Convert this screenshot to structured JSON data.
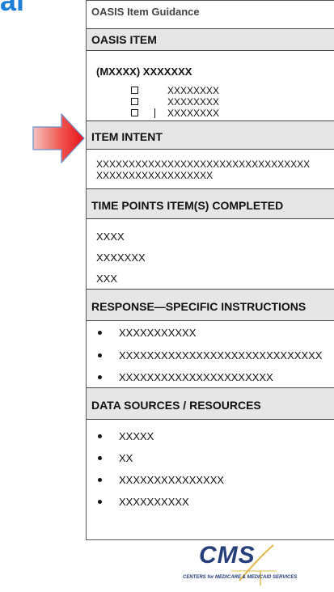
{
  "slide_heading_fragment": "al",
  "document": {
    "title": "OASIS Item Guidance",
    "sections": {
      "oasis_item": {
        "header": "OASIS ITEM",
        "item_line": "(MXXXX) XXXXXXX",
        "options": [
          "XXXXXXXX",
          "XXXXXXXX",
          "XXXXXXXX"
        ]
      },
      "item_intent": {
        "header": "ITEM INTENT",
        "lines": [
          "XXXXXXXXXXXXXXXXXXXXXXXXXXXXXXXXX",
          "XXXXXXXXXXXXXXXXXX"
        ]
      },
      "time_points": {
        "header": "TIME POINTS ITEM(S) COMPLETED",
        "lines": [
          "XXXX",
          "XXXXXXX",
          "XXX"
        ]
      },
      "response_instructions": {
        "header": "RESPONSE—SPECIFIC INSTRUCTIONS",
        "bullets": [
          "XXXXXXXXXXX",
          "XXXXXXXXXXXXXXXXXXXXXXXXXXXXX",
          "XXXXXXXXXXXXXXXXXXXXXX"
        ]
      },
      "data_sources": {
        "header": "DATA SOURCES / RESOURCES",
        "bullets": [
          "XXXXX",
          "XX",
          "XXXXXXXXXXXXXXX",
          "XXXXXXXXXX"
        ]
      }
    }
  },
  "logo": {
    "name": "CMS",
    "subtitle": "CENTERS for MEDICARE & MEDICAID SERVICES"
  },
  "colors": {
    "arrow_fill_start": "#e8141b",
    "arrow_fill_end": "#f6b7b3",
    "header_bar": "#e6e6e6",
    "logo_blue": "#253f7a",
    "logo_gold": "#e0b84a",
    "heading_blue": "#1c7ed6"
  }
}
